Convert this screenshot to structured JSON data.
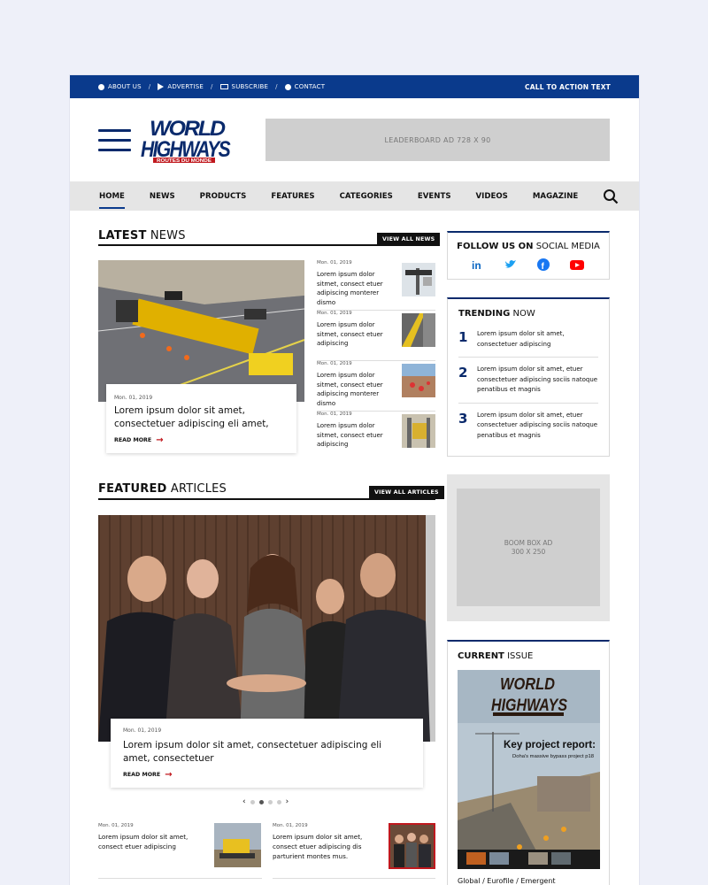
{
  "topbar": {
    "links": [
      {
        "label": "ABOUT US",
        "icon": "info-icon"
      },
      {
        "label": "ADVERTISE",
        "icon": "megaphone-icon"
      },
      {
        "label": "SUBSCRIBE",
        "icon": "book-icon"
      },
      {
        "label": "CONTACT",
        "icon": "user-icon"
      }
    ],
    "separator": "/",
    "cta": "CALL TO ACTION TEXT"
  },
  "header": {
    "logo_line1": "WORLD",
    "logo_line2": "HIGHWAYS",
    "logo_sub": "ROUTES DU MONDE",
    "leaderboard": "LEADERBOARD AD   728 X 90"
  },
  "nav": {
    "items": [
      "HOME",
      "NEWS",
      "PRODUCTS",
      "FEATURES",
      "CATEGORIES",
      "EVENTS",
      "VIDEOS",
      "MAGAZINE"
    ],
    "active": "HOME"
  },
  "latest": {
    "title_bold": "LATEST",
    "title_rest": " NEWS",
    "view_all": "VIEW ALL NEWS",
    "main": {
      "date": "Mon. 01, 2019",
      "title": "Lorem ipsum dolor sit amet, consectetuer adipiscing eli  amet,",
      "read_more": "READ MORE"
    },
    "side": [
      {
        "date": "Mon. 01, 2019",
        "text": "Lorem ipsum dolor sitmet, consect etuer adipiscing monterer dismo"
      },
      {
        "date": "Mon. 01, 2019",
        "text": "Lorem ipsum dolor sitmet, consect etuer adipiscing"
      },
      {
        "date": "Mon. 01, 2019",
        "text": "Lorem ipsum dolor sitmet, consect etuer adipiscing monterer dismo"
      },
      {
        "date": "Mon. 01, 2019",
        "text": "Lorem ipsum dolor sitmet, consect etuer adipiscing"
      }
    ]
  },
  "featured": {
    "title_bold": "FEATURED",
    "title_rest": " ARTICLES",
    "view_all": "VIEW ALL ARTICLES",
    "main": {
      "date": "Mon. 01, 2019",
      "title": "Lorem ipsum dolor sit amet, consectetuer adipiscing eli amet, consectetuer",
      "read_more": "READ MORE"
    },
    "carousel": {
      "prev": "‹",
      "next": "›",
      "count": 4,
      "active": 1
    },
    "bottom": [
      {
        "date": "Mon. 01, 2019",
        "text": "Lorem ipsum dolor sit amet, consect etuer adipiscing"
      },
      {
        "date": "Mon. 01, 2019",
        "text": "Lorem ipsum dolor sit amet, consect etuer adipiscing dis parturient montes mus."
      }
    ]
  },
  "social": {
    "title_bold": "FOLLOW US ON",
    "title_rest": " SOCIAL MEDIA",
    "networks": [
      {
        "name": "linkedin-icon",
        "color": "#0a66c2"
      },
      {
        "name": "twitter-icon",
        "color": "#1da1f2"
      },
      {
        "name": "facebook-icon",
        "color": "#1877f2"
      },
      {
        "name": "youtube-icon",
        "color": "#ff0000"
      }
    ]
  },
  "trending": {
    "title_bold": "TRENDING",
    "title_rest": " NOW",
    "items": [
      {
        "num": "1",
        "text": "Lorem ipsum dolor sit amet, consectetuer adipiscing"
      },
      {
        "num": "2",
        "text": "Lorem ipsum dolor sit amet, etuer consectetuer adipiscing sociis natoque penatibus et magnis"
      },
      {
        "num": "3",
        "text": "Lorem ipsum dolor sit amet, etuer consectetuer adipiscing sociis natoque penatibus et magnis"
      }
    ]
  },
  "boom_ad": "BOOM BOX AD\n300 X 250",
  "current_issue": {
    "title_bold": "CURRENT",
    "title_rest": " ISSUE",
    "cover_headline": "Key project report:",
    "cover_sub": "Doha's massive bypass project p18",
    "editions": "Global / Eurofile / Emergent"
  },
  "colors": {
    "brand": "#0a3a8c",
    "accent": "#c0181e"
  }
}
